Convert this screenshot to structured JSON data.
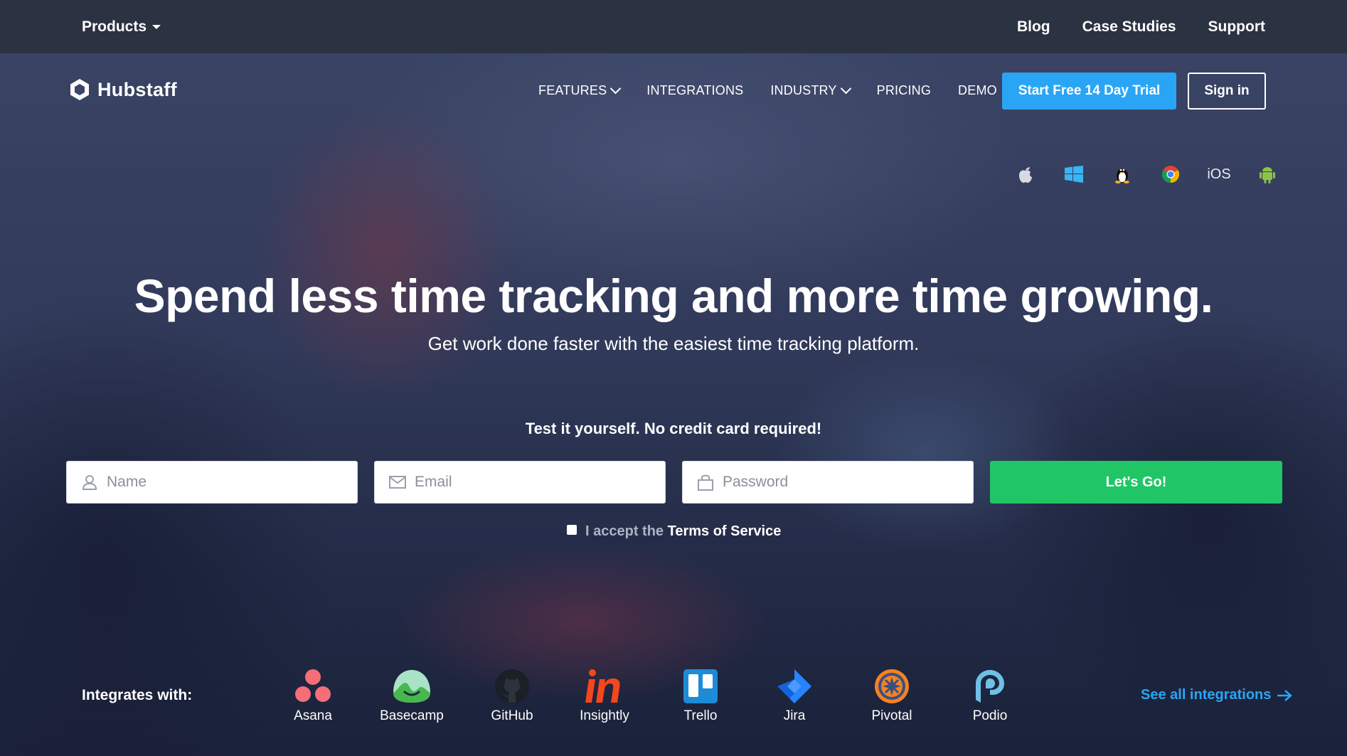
{
  "topbar": {
    "products_label": "Products",
    "links": [
      "Blog",
      "Case Studies",
      "Support"
    ]
  },
  "nav": {
    "logo_text": "Hubstaff",
    "items": [
      "FEATURES",
      "INTEGRATIONS",
      "INDUSTRY",
      "PRICING",
      "DEMO"
    ],
    "trial_button": "Start Free 14 Day Trial",
    "signin_button": "Sign in"
  },
  "platforms": {
    "icons": [
      "apple-icon",
      "windows-icon",
      "linux-icon",
      "chrome-icon",
      "ios",
      "android-icon"
    ],
    "ios_label": "iOS"
  },
  "hero": {
    "title": "Spend less time tracking and more time growing.",
    "subtitle": "Get work done faster with the easiest time tracking platform."
  },
  "signup": {
    "tagline": "Test it yourself. No credit card required!",
    "name_placeholder": "Name",
    "email_placeholder": "Email",
    "password_placeholder": "Password",
    "submit_label": "Let's Go!",
    "terms_prefix": "I accept the",
    "terms_link": "Terms of Service"
  },
  "integrations": {
    "label": "Integrates with:",
    "items": [
      "Asana",
      "Basecamp",
      "GitHub",
      "Insightly",
      "Trello",
      "Jira",
      "Pivotal",
      "Podio"
    ],
    "see_all": "See all integrations"
  },
  "colors": {
    "accent_blue": "#2aa5f6",
    "go_green": "#20c665",
    "topbar": "#2b3242"
  }
}
